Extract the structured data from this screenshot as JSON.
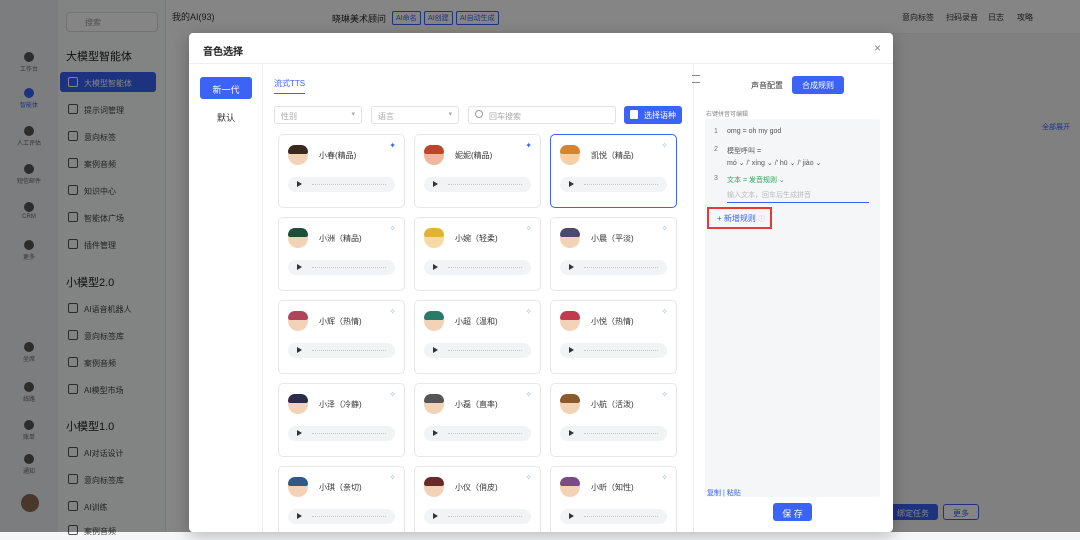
{
  "rail": {
    "items": [
      {
        "label": "工作台"
      },
      {
        "label": "智能体"
      },
      {
        "label": "人工评估"
      },
      {
        "label": "短信邮件"
      },
      {
        "label": "CRM"
      },
      {
        "label": "更多"
      },
      {
        "label": "坐席"
      },
      {
        "label": "线路"
      },
      {
        "label": "账单"
      },
      {
        "label": "通知"
      }
    ]
  },
  "sidebar": {
    "search_placeholder": "搜索",
    "sections": [
      {
        "title": "大模型智能体",
        "items": [
          "大模型智能体",
          "提示词管理",
          "意向标签",
          "案例音频",
          "知识中心",
          "智能体广场",
          "插件管理"
        ]
      },
      {
        "title": "小模型2.0",
        "items": [
          "AI语音机器人",
          "意向标签库",
          "案例音频",
          "AI模型市场"
        ]
      },
      {
        "title": "小模型1.0",
        "items": [
          "AI对话设计",
          "意向标签库",
          "AI训练",
          "案例音频"
        ]
      }
    ]
  },
  "background": {
    "my_ai": "我的AI(93)",
    "agent_title": "晓琳美术顾问",
    "tags": [
      "AI命名",
      "AI创建",
      "AI自动生成"
    ],
    "top_links": [
      "意向标签",
      "扫码录音",
      "日志",
      "攻略"
    ],
    "expand_all": "全部展开",
    "bind_task": "绑定任务",
    "more": "更多"
  },
  "modal": {
    "title": "音色选择",
    "close": "×",
    "left_tabs": [
      "新一代",
      "默认"
    ],
    "sub_tab": "流式TTS",
    "filters": {
      "gender": "性别",
      "language": "语言",
      "search_placeholder": "回车搜索",
      "pick_button": "选择语种"
    },
    "voices": [
      {
        "name": "小春(精品)",
        "pinned": true,
        "selected": false
      },
      {
        "name": "妮妮(精品)",
        "pinned": true,
        "selected": false
      },
      {
        "name": "凯悦（精品)",
        "pinned": false,
        "selected": true
      },
      {
        "name": "小洲（精品)",
        "pinned": false,
        "selected": false
      },
      {
        "name": "小婉（轻柔)",
        "pinned": false,
        "selected": false
      },
      {
        "name": "小晨（平淡)",
        "pinned": false,
        "selected": false
      },
      {
        "name": "小辉（热情)",
        "pinned": false,
        "selected": false
      },
      {
        "name": "小超（温和)",
        "pinned": false,
        "selected": false
      },
      {
        "name": "小悦（热情)",
        "pinned": false,
        "selected": false
      },
      {
        "name": "小泽（冷静)",
        "pinned": false,
        "selected": false
      },
      {
        "name": "小磊（直率)",
        "pinned": false,
        "selected": false
      },
      {
        "name": "小航（活泼)",
        "pinned": false,
        "selected": false
      },
      {
        "name": "小琪（亲切)",
        "pinned": false,
        "selected": false
      },
      {
        "name": "小仪（俏皮)",
        "pinned": false,
        "selected": false
      },
      {
        "name": "小昕（知性)",
        "pinned": false,
        "selected": false
      }
    ],
    "right": {
      "tab_voice_config": "声音配置",
      "tab_synth_rules": "合成规则",
      "hint": "右键拼音可编辑",
      "rules": [
        {
          "num": "1",
          "text": "omg = oh my god"
        },
        {
          "num": "2",
          "text": "模型呼叫 =",
          "pinyin": "mó ⌄  /' xíng ⌄  /' hū ⌄  /' jiào ⌄"
        },
        {
          "num": "3",
          "text": "文本 = 发音规则 ⌄",
          "placeholder": "输入文本，回车后生成拼音"
        }
      ],
      "add_rule": "+ 新增规则",
      "help": "ⓘ",
      "copy_paste": "复制  |  粘贴",
      "save": "保 存"
    }
  }
}
